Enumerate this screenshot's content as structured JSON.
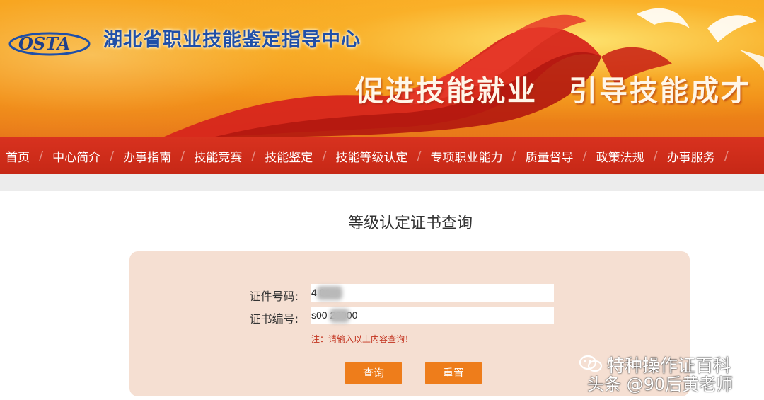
{
  "header": {
    "logo_text": "OSTA",
    "site_title": "湖北省职业技能鉴定指导中心",
    "slogan_left": "促进技能就业",
    "slogan_right": "引导技能成才"
  },
  "nav": {
    "items": [
      {
        "label": "首页"
      },
      {
        "label": "中心简介"
      },
      {
        "label": "办事指南"
      },
      {
        "label": "技能竞赛"
      },
      {
        "label": "技能鉴定"
      },
      {
        "label": "技能等级认定"
      },
      {
        "label": "专项职业能力"
      },
      {
        "label": "质量督导"
      },
      {
        "label": "政策法规"
      },
      {
        "label": "办事服务"
      }
    ]
  },
  "main": {
    "title": "等级认定证书查询",
    "form": {
      "id_label": "证件号码:",
      "id_value": "4        01",
      "cert_label": "证书编号:",
      "cert_value": "s00        20000",
      "note": "注：请输入以上内容查询！",
      "query_button": "查询",
      "reset_button": "重置"
    }
  },
  "watermark": {
    "line1": "特种操作证百科",
    "line2": "头条 @90后黄老师"
  },
  "colors": {
    "nav_bg": "#d0301b",
    "button": "#ee7d1b",
    "panel": "#f5dfd2",
    "note": "#c2321e",
    "title_blue": "#1f4fa8"
  }
}
